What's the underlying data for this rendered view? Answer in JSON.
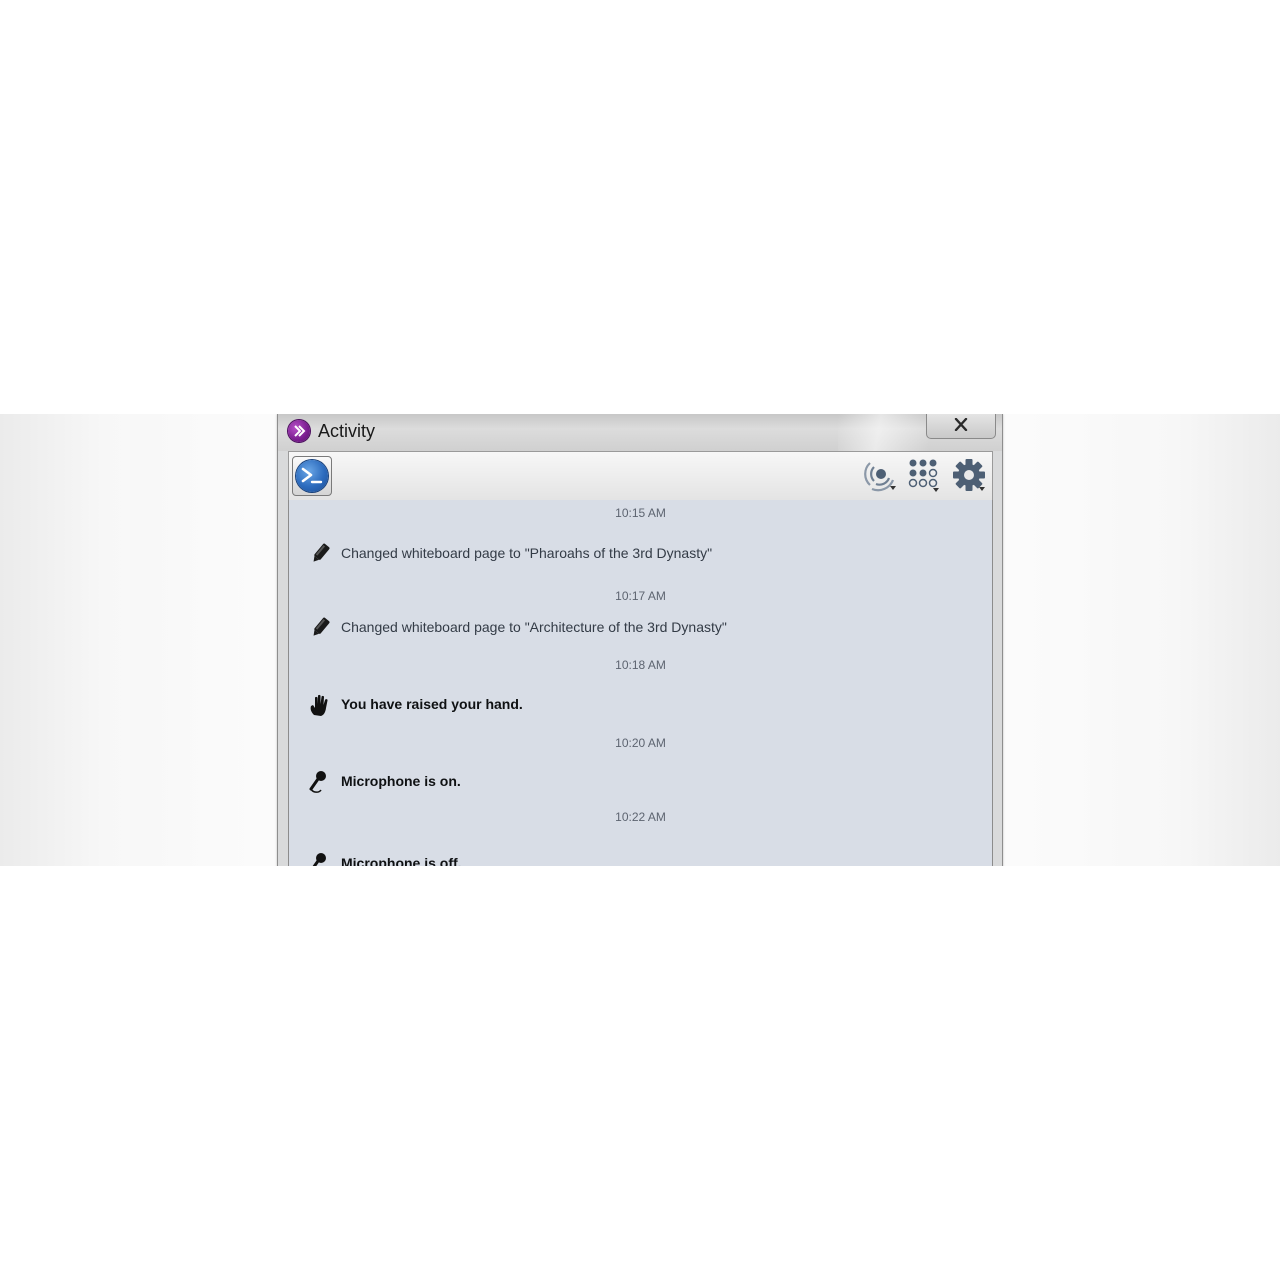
{
  "window": {
    "title": "Activity",
    "close_label": "×"
  },
  "toolbar": {
    "console_icon": "powershell-console-icon",
    "buttons": [
      {
        "icon": "broadcast-icon"
      },
      {
        "icon": "seating-grid-icon"
      },
      {
        "icon": "gear-icon"
      }
    ]
  },
  "feed": {
    "items": [
      {
        "time": "10:15 AM",
        "icon": "marker-icon",
        "text": "Changed whiteboard page to \"Pharoahs of the 3rd Dynasty\"",
        "bold": false
      },
      {
        "time": "10:17 AM",
        "icon": "marker-icon",
        "text": "Changed whiteboard page to \"Architecture of the 3rd Dynasty\"",
        "bold": false
      },
      {
        "time": "10:18 AM",
        "icon": "raised-hand-icon",
        "text": "You have raised your hand.",
        "bold": true
      },
      {
        "time": "10:20 AM",
        "icon": "microphone-icon",
        "text": "Microphone is on.",
        "bold": true
      },
      {
        "time": "10:22 AM",
        "icon": "microphone-icon",
        "text": "Microphone is off.",
        "bold": true
      }
    ]
  }
}
